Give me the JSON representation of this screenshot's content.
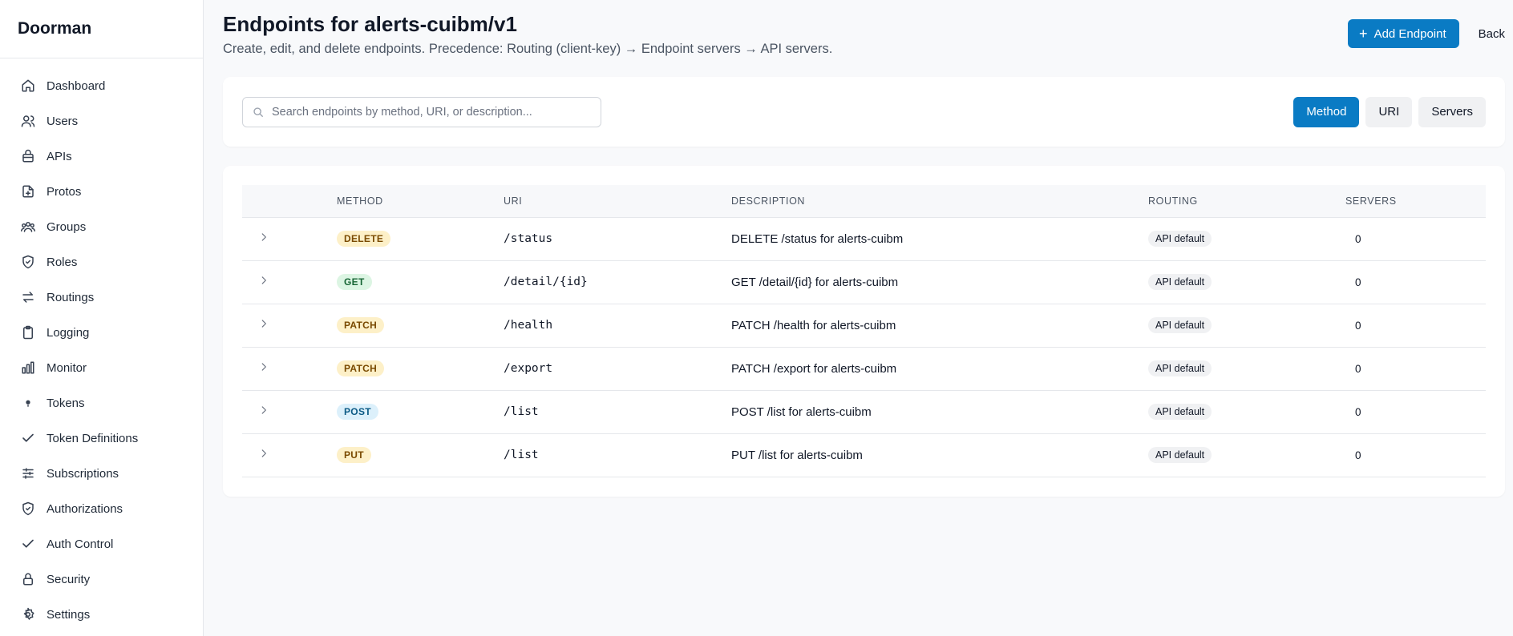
{
  "app": {
    "title": "Doorman"
  },
  "sidebar": {
    "items": [
      {
        "label": "Dashboard",
        "icon": "home-icon"
      },
      {
        "label": "Users",
        "icon": "users-icon"
      },
      {
        "label": "APIs",
        "icon": "api-icon"
      },
      {
        "label": "Protos",
        "icon": "proto-icon"
      },
      {
        "label": "Groups",
        "icon": "groups-icon"
      },
      {
        "label": "Roles",
        "icon": "shield-icon"
      },
      {
        "label": "Routings",
        "icon": "routing-icon"
      },
      {
        "label": "Logging",
        "icon": "clipboard-icon"
      },
      {
        "label": "Monitor",
        "icon": "bar-chart-icon"
      },
      {
        "label": "Tokens",
        "icon": "dot-icon"
      },
      {
        "label": "Token Definitions",
        "icon": "check-icon"
      },
      {
        "label": "Subscriptions",
        "icon": "sliders-icon"
      },
      {
        "label": "Authorizations",
        "icon": "shield-check-icon"
      },
      {
        "label": "Auth Control",
        "icon": "check-icon"
      },
      {
        "label": "Security",
        "icon": "lock-icon"
      },
      {
        "label": "Settings",
        "icon": "gear-icon"
      }
    ]
  },
  "header": {
    "title": "Endpoints for alerts-cuibm/v1",
    "subtitle": "Create, edit, and delete endpoints. Precedence: Routing (client-key) → Endpoint servers → API servers.",
    "add_label": "Add Endpoint",
    "back_label": "Back"
  },
  "search": {
    "placeholder": "Search endpoints by method, URI, or description...",
    "value": ""
  },
  "sort": {
    "buttons": [
      "Method",
      "URI",
      "Servers"
    ],
    "active": "Method",
    "active_color": "#0a7bc4"
  },
  "table": {
    "headers": [
      "METHOD",
      "URI",
      "DESCRIPTION",
      "ROUTING",
      "SERVERS"
    ],
    "rows": [
      {
        "method": "DELETE",
        "uri": "/status",
        "description": "DELETE /status for alerts-cuibm",
        "routing": "API default",
        "servers": "0"
      },
      {
        "method": "GET",
        "uri": "/detail/{id}",
        "description": "GET /detail/{id} for alerts-cuibm",
        "routing": "API default",
        "servers": "0"
      },
      {
        "method": "PATCH",
        "uri": "/health",
        "description": "PATCH /health for alerts-cuibm",
        "routing": "API default",
        "servers": "0"
      },
      {
        "method": "PATCH",
        "uri": "/export",
        "description": "PATCH /export for alerts-cuibm",
        "routing": "API default",
        "servers": "0"
      },
      {
        "method": "POST",
        "uri": "/list",
        "description": "POST /list for alerts-cuibm",
        "routing": "API default",
        "servers": "0"
      },
      {
        "method": "PUT",
        "uri": "/list",
        "description": "PUT /list for alerts-cuibm",
        "routing": "API default",
        "servers": "0"
      }
    ]
  },
  "method_colors": {
    "DELETE": {
      "bg": "#fdf0c8",
      "fg": "#7a4a00"
    },
    "GET": {
      "bg": "#dcf5e3",
      "fg": "#166534"
    },
    "PATCH": {
      "bg": "#fdf0c8",
      "fg": "#7a4a00"
    },
    "POST": {
      "bg": "#dcf0fb",
      "fg": "#0b5a85"
    },
    "PUT": {
      "bg": "#fdf0c8",
      "fg": "#7a4a00"
    }
  }
}
